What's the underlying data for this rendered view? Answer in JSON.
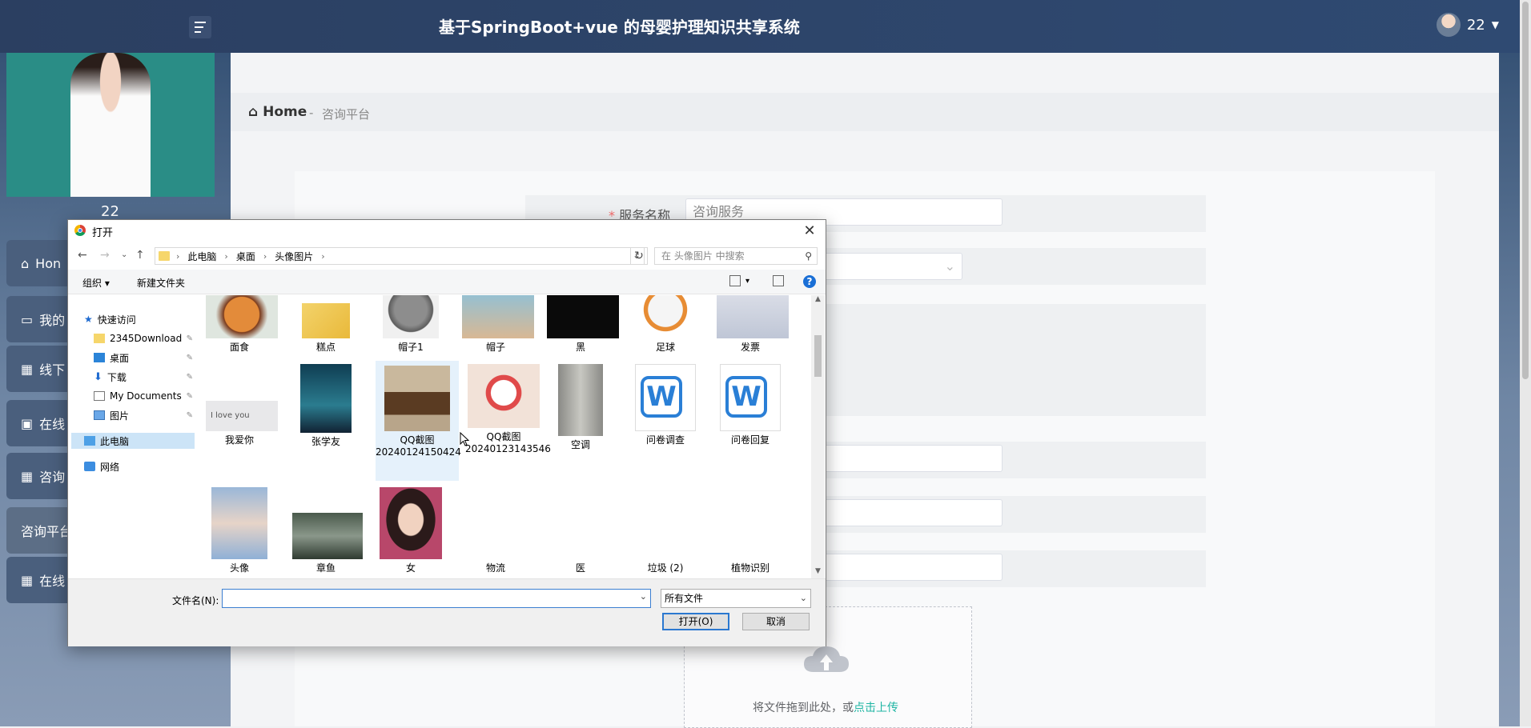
{
  "app": {
    "title": "基于SpringBoot+vue 的母婴护理知识共享系统",
    "username": "22"
  },
  "sidebar": {
    "name": "22",
    "items": [
      {
        "label": "Hon"
      },
      {
        "label": "我的"
      },
      {
        "label": "线下"
      },
      {
        "label": "在线"
      },
      {
        "label": "咨询"
      },
      {
        "label": "咨询平台"
      },
      {
        "label": "在线"
      }
    ]
  },
  "breadcrumb": {
    "home": "Home",
    "sep": "-",
    "current": "咨询平台"
  },
  "form": {
    "service_name_label": "服务名称",
    "required_mark": "*",
    "service_name_value": "咨询服务",
    "upload_text": "将文件拖到此处，或",
    "upload_link": "点击上传"
  },
  "dialog": {
    "title": "打开",
    "path": [
      "此电脑",
      "桌面",
      "头像图片"
    ],
    "search_placeholder": "在 头像图片 中搜索",
    "toolbar": {
      "organize": "组织 ▾",
      "new_folder": "新建文件夹",
      "help": "?"
    },
    "nav": [
      {
        "label": "快速访问",
        "icon": "star-icon"
      },
      {
        "label": "2345Download",
        "icon": "folder-icon"
      },
      {
        "label": "桌面",
        "icon": "desktop-icon"
      },
      {
        "label": "下载",
        "icon": "download-icon"
      },
      {
        "label": "My Documents",
        "icon": "document-icon"
      },
      {
        "label": "图片",
        "icon": "pictures-icon"
      },
      {
        "label": "此电脑",
        "icon": "computer-icon"
      },
      {
        "label": "网络",
        "icon": "network-icon"
      }
    ],
    "files_row1": [
      "面食",
      "糕点",
      "帽子1",
      "帽子",
      "黑",
      "足球",
      "发票"
    ],
    "files_row2": [
      "我爱你",
      "张学友",
      "QQ截图\n20240124150424",
      "QQ截图\n20240123143546",
      "空调",
      "问卷调查",
      "问卷回复"
    ],
    "files_row3": [
      "头像",
      "章鱼",
      "女",
      "物流",
      "医",
      "垃圾 (2)",
      "植物识别"
    ],
    "love_text": "I love you",
    "filename_label": "文件名(N):",
    "filter_value": "所有文件",
    "open_label": "打开(O)",
    "cancel_label": "取消"
  },
  "colors": {
    "accent": "#1fb5a3",
    "header": "#2b3f61",
    "selection": "#cce4f7"
  }
}
